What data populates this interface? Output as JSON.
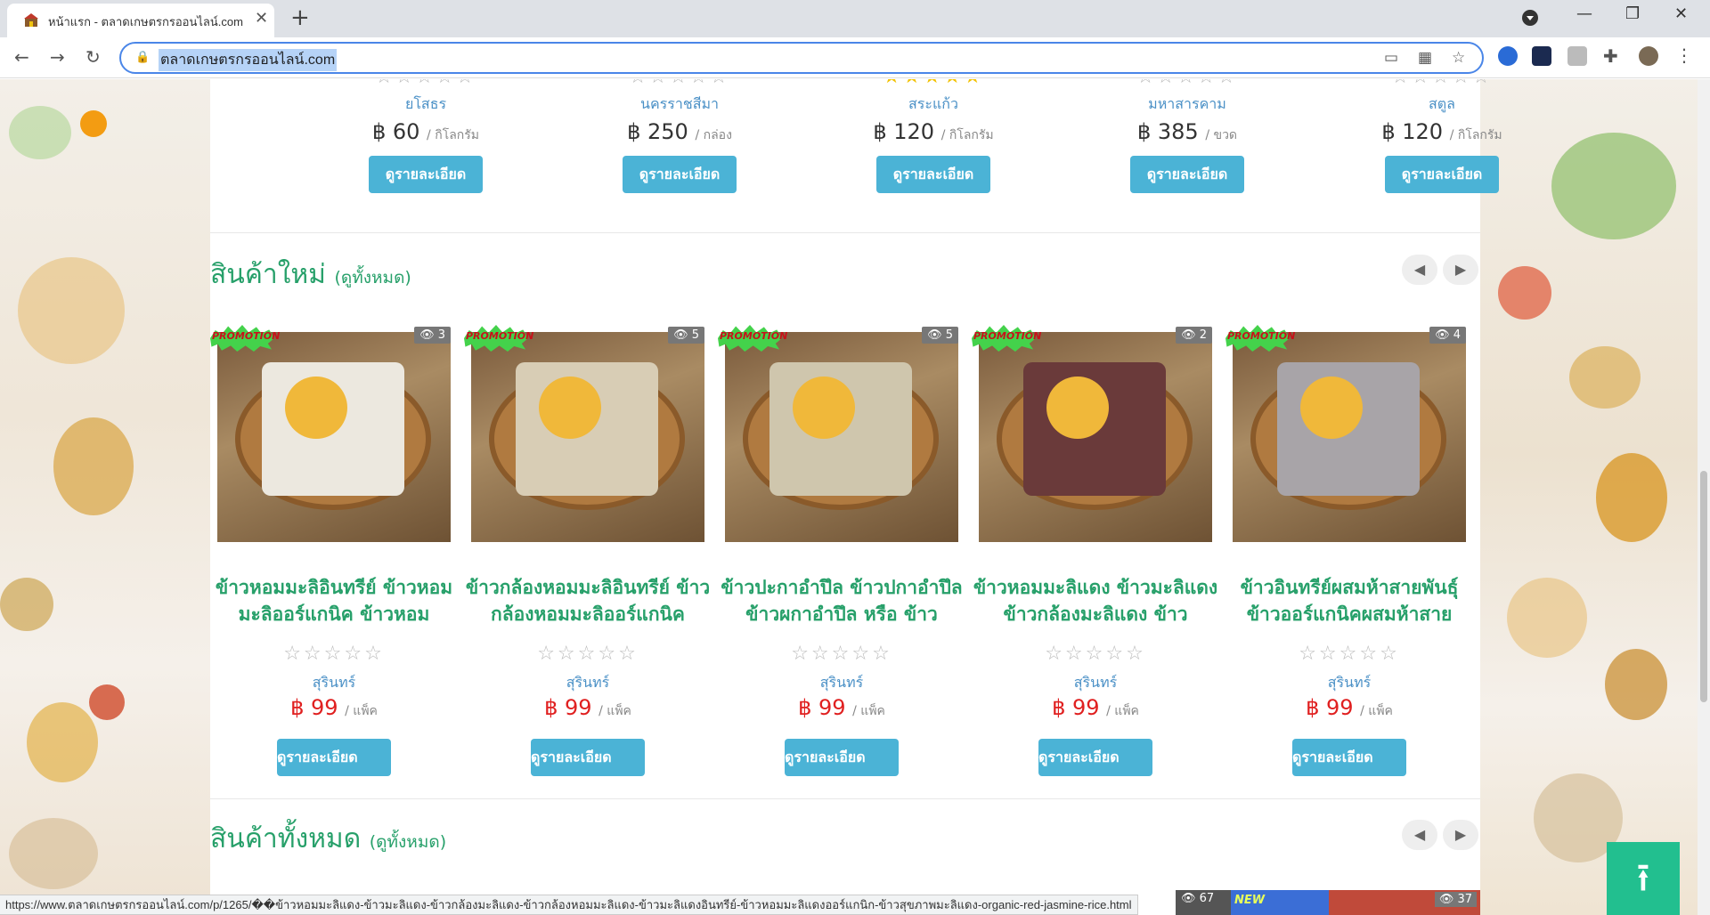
{
  "browser": {
    "tab_title": "หน้าแรก - ตลาดเกษตรกรออนไลน์.com",
    "url": "ตลาดเกษตรกรออนไลน์.com",
    "status_url": "https://www.ตลาดเกษตรกรออนไลน์.com/p/1265/��ข้าวหอมมะลิแดง-ข้าวมะลิแดง-ข้าวกล้องมะลิแดง-ข้าวกล้องหอมมะลิแดง-ข้าวมะลิแดงอินทรีย์-ข้าวหอมมะลิแดงออร์แกนิก-ข้าวสุขภาพมะลิแดง-organic-red-jasmine-rice.html"
  },
  "top_products": [
    {
      "province": "ยโสธร",
      "price": "฿ 60",
      "unit": "/ กิโลกรัม",
      "stars": "☆☆☆☆☆",
      "button": "ดูรายละเอียด"
    },
    {
      "province": "นครราชสีมา",
      "price": "฿ 250",
      "unit": "/ กล่อง",
      "stars": "☆☆☆☆☆",
      "button": "ดูรายละเอียด"
    },
    {
      "province": "สระแก้ว",
      "price": "฿ 120",
      "unit": "/ กิโลกรัม",
      "stars": "★★★★★",
      "button": "ดูรายละเอียด"
    },
    {
      "province": "มหาสารคาม",
      "price": "฿ 385",
      "unit": "/ ขวด",
      "stars": "☆☆☆☆☆",
      "button": "ดูรายละเอียด"
    },
    {
      "province": "สตูล",
      "price": "฿ 120",
      "unit": "/ กิโลกรัม",
      "stars": "☆☆☆☆☆",
      "button": "ดูรายละเอียด"
    }
  ],
  "new_section": {
    "title": "สินค้าใหม่",
    "all": "(ดูทั้งหมด)"
  },
  "all_section": {
    "title": "สินค้าทั้งหมด",
    "all": "(ดูทั้งหมด)"
  },
  "promo_text": "PROMOTION",
  "new_products": [
    {
      "views": "👁 3",
      "name": "ข้าวหอมมะลิอินทรีย์ ข้าวหอมมะลิออร์แกนิค ข้าวหอม",
      "stars": "☆☆☆☆☆",
      "province": "สุรินทร์",
      "price": "฿ 99",
      "unit": "/ แพ็ค",
      "button": "ดูรายละเอียด",
      "pack_color": "#ece8df"
    },
    {
      "views": "👁 5",
      "name": "ข้าวกล้องหอมมะลิอินทรีย์ ข้าวกล้องหอมมะลิออร์แกนิค",
      "stars": "☆☆☆☆☆",
      "province": "สุรินทร์",
      "price": "฿ 99",
      "unit": "/ แพ็ค",
      "button": "ดูรายละเอียด",
      "pack_color": "#d8cdb5"
    },
    {
      "views": "👁 5",
      "name": "ข้าวปะกาอำปึล ข้าวปกาอำปึล ข้าวผกาอำปึล หรือ ข้าว",
      "stars": "☆☆☆☆☆",
      "province": "สุรินทร์",
      "price": "฿ 99",
      "unit": "/ แพ็ค",
      "button": "ดูรายละเอียด",
      "pack_color": "#cfc6ad"
    },
    {
      "views": "👁 2",
      "name": "ข้าวหอมมะลิแดง ข้าวมะลิแดง ข้าวกล้องมะลิแดง ข้าว",
      "stars": "☆☆☆☆☆",
      "province": "สุรินทร์",
      "price": "฿ 99",
      "unit": "/ แพ็ค",
      "button": "ดูรายละเอียด",
      "pack_color": "#6a3a3a"
    },
    {
      "views": "👁 4",
      "name": "ข้าวอินทรีย์ผสมห้าสายพันธุ์ ข้าวออร์แกนิคผสมห้าสาย",
      "stars": "☆☆☆☆☆",
      "province": "สุรินทร์",
      "price": "฿ 99",
      "unit": "/ แพ็ค",
      "button": "ดูรายละเอียด",
      "pack_color": "#a8a4a8"
    }
  ],
  "peek": {
    "views_a": "👁 67",
    "views_b": "👁 37",
    "new_text": "NEW"
  },
  "icons": [
    "favicon-icon",
    "close-icon",
    "plus-icon",
    "back-icon",
    "forward-icon",
    "reload-icon",
    "lock-icon",
    "star-icon",
    "extensions-icon",
    "menu-icon",
    "chevron-left-icon",
    "chevron-right-icon",
    "eye-icon",
    "arrow-up-icon"
  ]
}
